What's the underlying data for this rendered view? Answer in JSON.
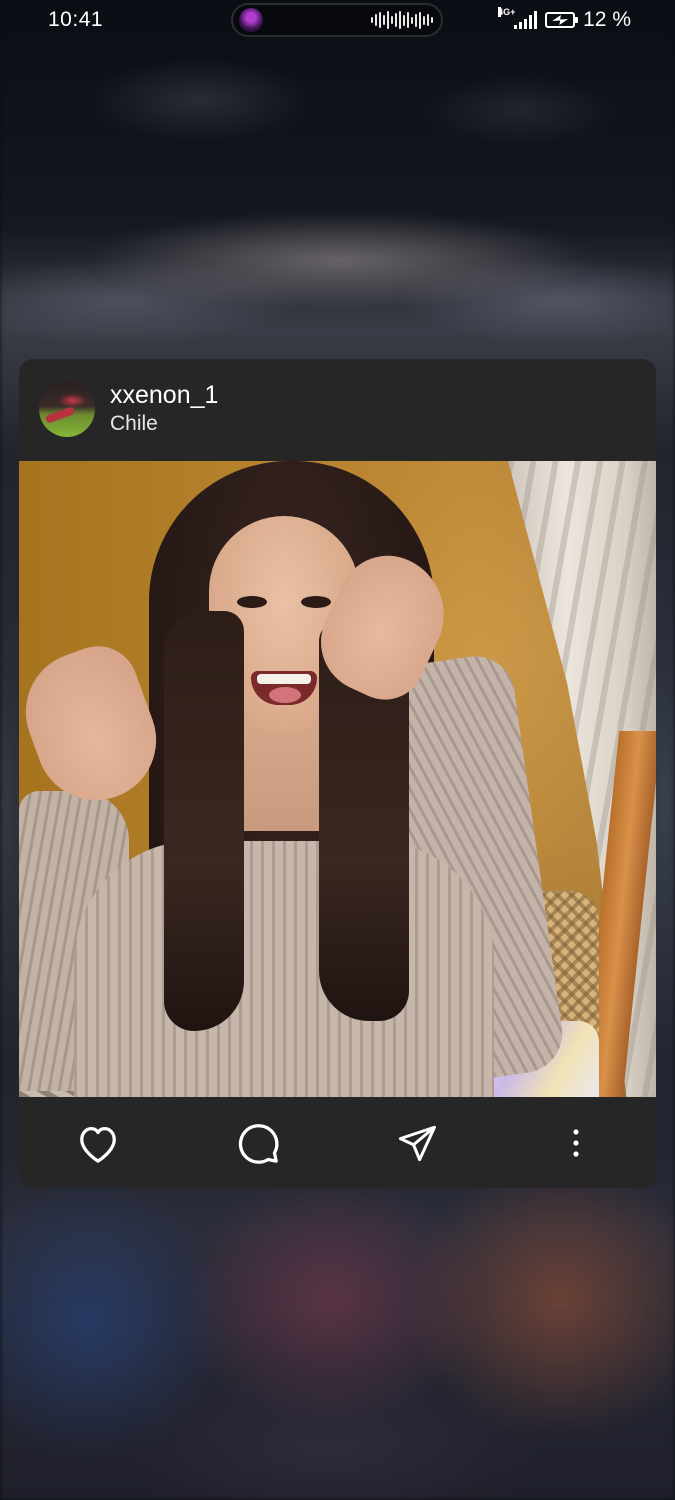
{
  "status_bar": {
    "time": "10:41",
    "network": "4G+",
    "battery_percent": "12 %",
    "icons": [
      "signal-icon",
      "battery-charging-icon"
    ]
  },
  "island": {
    "icons": [
      "music-avatar-icon",
      "audio-waveform-icon"
    ]
  },
  "post": {
    "username": "xxenon_1",
    "location": "Chile",
    "avatar_icon": "profile-avatar",
    "image_icon": "post-photo"
  },
  "actions": {
    "icons": [
      "heart-icon",
      "comment-icon",
      "send-icon",
      "more-vertical-icon"
    ]
  },
  "colors": {
    "card_background": "#262626",
    "icon_color": "#ffffff",
    "text_primary": "#ffffff"
  }
}
